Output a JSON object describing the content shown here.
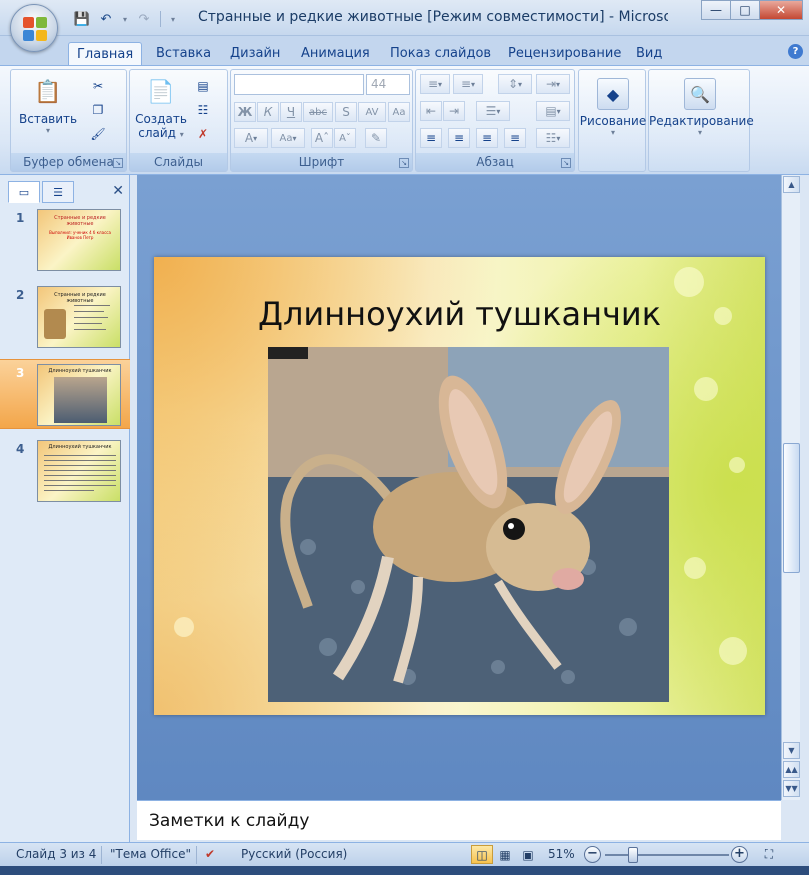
{
  "window": {
    "title": "Странные и редкие животные [Режим совместимости] - Microsof..."
  },
  "tabs": [
    {
      "label": "Главная"
    },
    {
      "label": "Вставка"
    },
    {
      "label": "Дизайн"
    },
    {
      "label": "Анимация"
    },
    {
      "label": "Показ слайдов"
    },
    {
      "label": "Рецензирование"
    },
    {
      "label": "Вид"
    }
  ],
  "ribbon": {
    "clipboard": {
      "paste_label": "Вставить",
      "group_label": "Буфер обмена"
    },
    "slides": {
      "new_slide_label_1": "Создать",
      "new_slide_label_2": "слайд",
      "group_label": "Слайды"
    },
    "font": {
      "font_name": "",
      "font_size": "44",
      "group_label": "Шрифт"
    },
    "paragraph": {
      "group_label": "Абзац"
    },
    "drawing": {
      "label": "Рисование"
    },
    "editing": {
      "label": "Редактирование"
    }
  },
  "thumbnails": [
    {
      "number": "1",
      "title": "Странные и редкие животные",
      "subtitle": "Выполнил: ученик 4 б класса Иванов Петр"
    },
    {
      "number": "2",
      "title": "Странные и редкие животные"
    },
    {
      "number": "3",
      "title": "Длинноухий тушканчик"
    },
    {
      "number": "4",
      "title": "Длинноухий тушканчик"
    }
  ],
  "slide": {
    "title": "Длинноухий тушканчик"
  },
  "notes": {
    "placeholder": "Заметки к слайду"
  },
  "status": {
    "slide_info": "Слайд 3 из 4",
    "theme": "\"Тема Office\"",
    "language": "Русский (Россия)",
    "zoom": "51%",
    "zoom_value": 51
  },
  "colors": {
    "ribbon_text": "#15428b",
    "selected_thumb": "#f3a64a",
    "workspace": "#6d93c7"
  }
}
